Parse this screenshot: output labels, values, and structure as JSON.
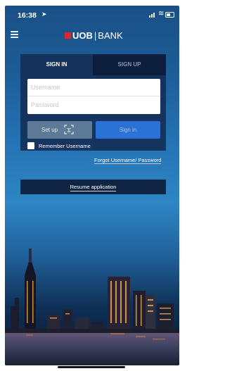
{
  "status_bar": {
    "time": "16:38"
  },
  "header": {
    "brand_primary": "UOB",
    "brand_separator": "|",
    "brand_secondary": "BANK"
  },
  "login": {
    "tabs": [
      {
        "label": "SIGN IN",
        "active": true
      },
      {
        "label": "SIGN UP",
        "active": false
      }
    ],
    "username_placeholder": "Username",
    "password_placeholder": "Password",
    "setup_label": "Set up",
    "signin_label": "Sign in",
    "remember_label": "Remember Username",
    "forgot_label": "Forgot Username/ Password"
  },
  "resume": {
    "label": "Resume application"
  },
  "colors": {
    "brand_red": "#d8282f",
    "accent_blue": "#2b72d6",
    "panel_navy": "#142d55"
  }
}
